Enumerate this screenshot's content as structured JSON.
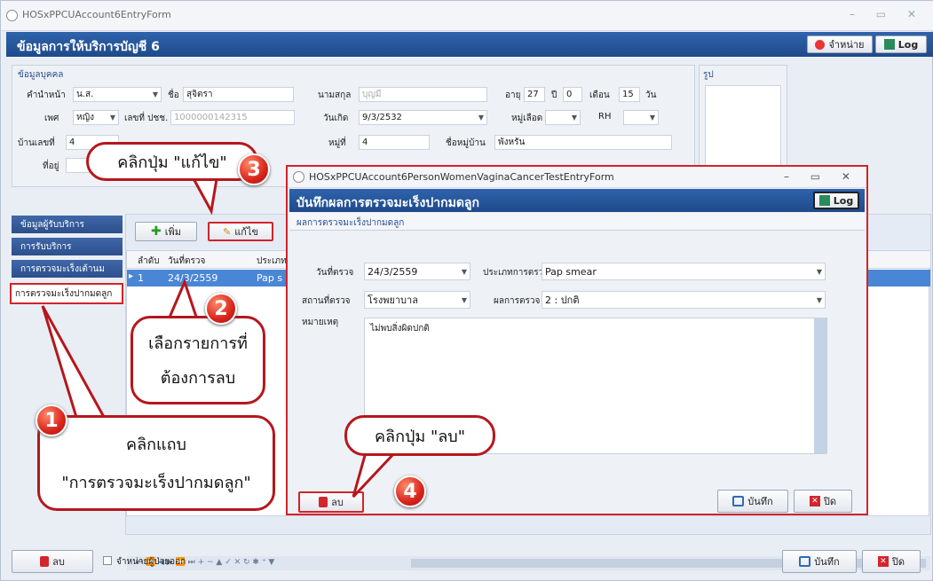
{
  "window": {
    "title": "HOSxPPCUAccount6EntryForm"
  },
  "header": {
    "title": "ข้อมูลการให้บริการบัญชี 6",
    "discharge_label": "จำหน่าย",
    "log_label": "Log"
  },
  "person": {
    "group_title": "ข้อมูลบุคคล",
    "photo_title": "รูป",
    "prefix_label": "คำนำหน้า",
    "prefix": "น.ส.",
    "name_label": "ชื่อ",
    "name": "สุจิตรา",
    "surname_label": "นามสกุล",
    "surname": "บุญมี",
    "age_label": "อายุ",
    "age_y": "27",
    "y_label": "ปี",
    "age_m": "0",
    "m_label": "เดือน",
    "age_d": "15",
    "d_label": "วัน",
    "sex_label": "เพศ",
    "sex": "หญิง",
    "cid_label": "เลขที่ ปชช.",
    "cid": "1000000142315",
    "dob_label": "วันเกิด",
    "dob": "9/3/2532",
    "blood_label": "หมู่เลือด",
    "rh_label": "RH",
    "house_label": "บ้านเลขที่",
    "house": "4",
    "moo_label": "หมู่ที่",
    "moo": "4",
    "village_label": "ชื่อหมู่บ้าน",
    "village": "พังหรัน",
    "address_label": "ที่อยู่"
  },
  "sidebar": {
    "items": [
      {
        "label": "ข้อมูลผู้รับบริการ"
      },
      {
        "label": "การรับบริการ"
      },
      {
        "label": "การตรวจมะเร็งเต้านม"
      },
      {
        "label": "การตรวจมะเร็งปากมดลูก"
      }
    ]
  },
  "toolbar": {
    "add_label": "เพิ่ม",
    "edit_label": "แก้ไข"
  },
  "table": {
    "columns": [
      "ลำดับ",
      "วันที่ตรวจ",
      "ประเภท"
    ],
    "rows": [
      [
        "1",
        "24/3/2559",
        "Pap s"
      ]
    ]
  },
  "nav": {
    "text": "⏮ ⏪ ◀ ▶ ⏩ ⏭ + − ▲ ✓ ✕ ↻ ✱ ⁺ ▼"
  },
  "footer": {
    "delete_label": "ลบ",
    "discharge_checkbox": "จำหน่ายผู้ป่วยออก",
    "save_label": "บันทึก",
    "close_label": "ปิด"
  },
  "dialog": {
    "window_title": "HOSxPPCUAccount6PersonWomenVaginaCancerTestEntryForm",
    "title": "บันทึกผลการตรวจมะเร็งปากมดลูก",
    "log_label": "Log",
    "section": "ผลการตรวจมะเร็งปากมดลูก",
    "date_label": "วันที่ตรวจ",
    "date": "24/3/2559",
    "type_label": "ประเภทการตรวจ",
    "type": "Pap smear",
    "place_label": "สถานที่ตรวจ",
    "place": "โรงพยาบาล",
    "result_label": "ผลการตรวจ",
    "result": "2 : ปกติ",
    "note_label": "หมายเหตุ",
    "note": "ไม่พบสิ่งผิดปกติ",
    "delete_label": "ลบ",
    "save_label": "บันทึก",
    "close_label": "ปิด"
  },
  "callouts": {
    "c3": "คลิกปุ่ม \"แก้ไข\"",
    "n3": "3",
    "c2a": "เลือกรายการที่",
    "c2b": "ต้องการลบ",
    "n2": "2",
    "c1a": "คลิกแถบ",
    "c1b": "\"การตรวจมะเร็งปากมดลูก\"",
    "n1": "1",
    "c4": "คลิกปุ่ม \"ลบ\"",
    "n4": "4"
  }
}
